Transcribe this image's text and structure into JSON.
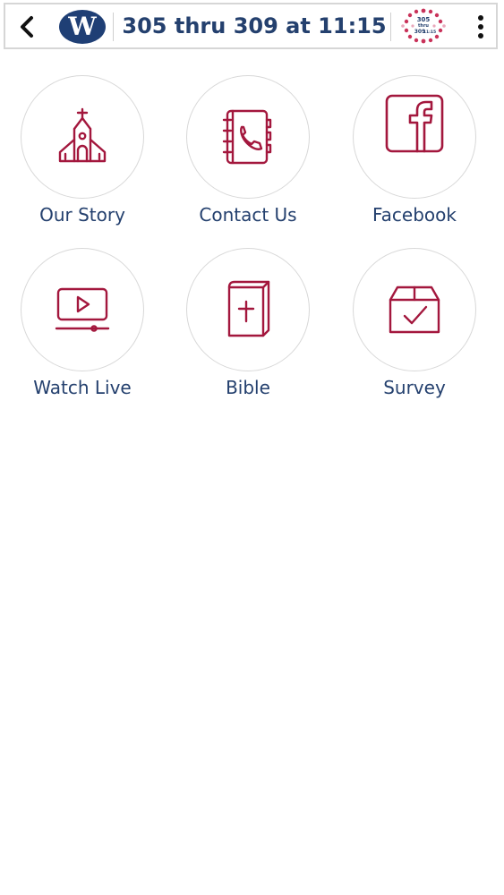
{
  "header": {
    "title": "305 thru 309 at 11:15",
    "logo_letter": "W",
    "right_logo_text": [
      "305",
      "thru",
      "309",
      "11:15"
    ]
  },
  "tiles": [
    {
      "label": "Our Story",
      "icon": "church-icon"
    },
    {
      "label": "Contact Us",
      "icon": "address-book-phone-icon"
    },
    {
      "label": "Facebook",
      "icon": "facebook-icon"
    },
    {
      "label": "Watch Live",
      "icon": "video-play-icon"
    },
    {
      "label": "Bible",
      "icon": "bible-icon"
    },
    {
      "label": "Survey",
      "icon": "survey-box-check-icon"
    }
  ],
  "colors": {
    "icon": "#a3173d",
    "label": "#24406e",
    "circle_border": "#d8d8d8",
    "logo_bg": "#1f3f75"
  }
}
